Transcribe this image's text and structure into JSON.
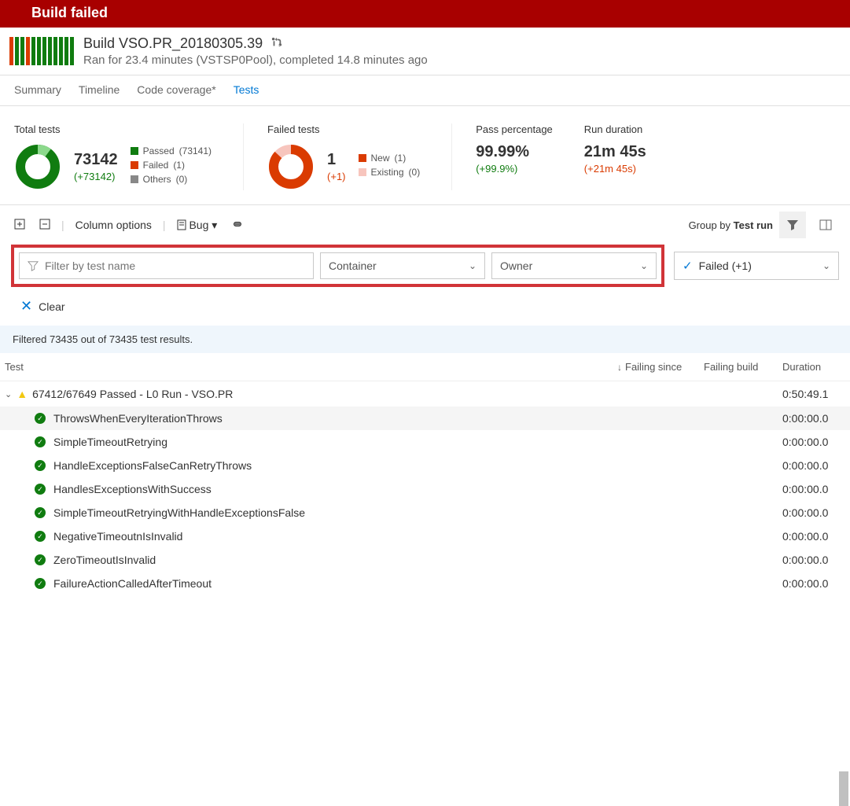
{
  "banner": {
    "title": "Build failed"
  },
  "header": {
    "title": "Build VSO.PR_20180305.39",
    "subtitle": "Ran for 23.4 minutes (VSTSP0Pool), completed 14.8 minutes ago"
  },
  "tabs": [
    {
      "label": "Summary",
      "active": false
    },
    {
      "label": "Timeline",
      "active": false
    },
    {
      "label": "Code coverage*",
      "active": false
    },
    {
      "label": "Tests",
      "active": true
    }
  ],
  "stats": {
    "total": {
      "label": "Total tests",
      "value": "73142",
      "delta": "(+73142)",
      "legend": [
        {
          "color": "green",
          "label": "Passed",
          "count": "(73141)"
        },
        {
          "color": "red",
          "label": "Failed",
          "count": "(1)"
        },
        {
          "color": "gray",
          "label": "Others",
          "count": "(0)"
        }
      ]
    },
    "failed": {
      "label": "Failed tests",
      "value": "1",
      "delta": "(+1)",
      "legend": [
        {
          "color": "red",
          "label": "New",
          "count": "(1)"
        },
        {
          "color": "pink",
          "label": "Existing",
          "count": "(0)"
        }
      ]
    },
    "pass": {
      "label": "Pass percentage",
      "value": "99.99%",
      "delta": "(+99.9%)"
    },
    "duration": {
      "label": "Run duration",
      "value": "21m 45s",
      "delta": "(+21m 45s)"
    }
  },
  "toolbar": {
    "column_options": "Column options",
    "bug": "Bug",
    "group_by_label": "Group by",
    "group_by_value": "Test run"
  },
  "filters": {
    "name_placeholder": "Filter by test name",
    "container": "Container",
    "owner": "Owner",
    "outcome": "Failed (+1)"
  },
  "clear": "Clear",
  "filter_msg": "Filtered 73435 out of 73435 test results.",
  "columns": {
    "test": "Test",
    "failing_since": "Failing since",
    "failing_build": "Failing build",
    "duration": "Duration"
  },
  "group": {
    "title": "67412/67649 Passed - L0 Run - VSO.PR",
    "duration": "0:50:49.1"
  },
  "rows": [
    {
      "name": "ThrowsWhenEveryIterationThrows",
      "dur": "0:00:00.0",
      "sel": true
    },
    {
      "name": "SimpleTimeoutRetrying",
      "dur": "0:00:00.0"
    },
    {
      "name": "HandleExceptionsFalseCanRetryThrows",
      "dur": "0:00:00.0"
    },
    {
      "name": "HandlesExceptionsWithSuccess",
      "dur": "0:00:00.0"
    },
    {
      "name": "SimpleTimeoutRetryingWithHandleExceptionsFalse",
      "dur": "0:00:00.0"
    },
    {
      "name": "NegativeTimeoutnIsInvalid",
      "dur": "0:00:00.0"
    },
    {
      "name": "ZeroTimeoutIsInvalid",
      "dur": "0:00:00.0"
    },
    {
      "name": "FailureActionCalledAfterTimeout",
      "dur": "0:00:00.0"
    }
  ]
}
